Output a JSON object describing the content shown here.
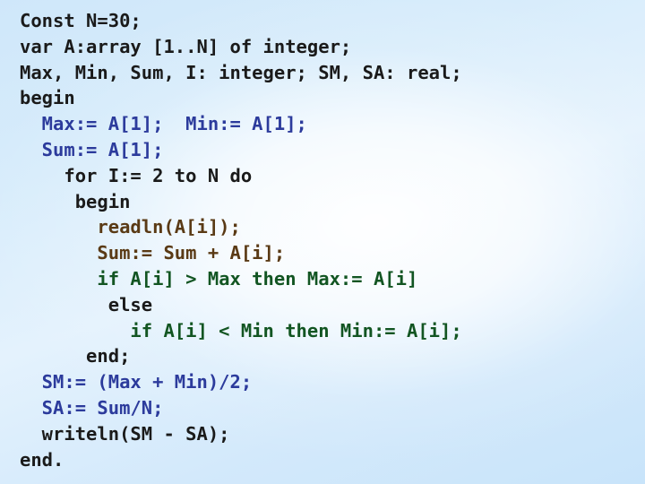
{
  "slide": {
    "title": "Pascal code listing slide",
    "background": {
      "type": "gradient",
      "colors": [
        "#cfe7fa",
        "#e4f2fd",
        "#c8e4fa"
      ]
    },
    "palette": {
      "black": "#1a1a1a",
      "blue": "#2c3b9c",
      "brown": "#5a3a15",
      "green": "#125522"
    },
    "code_lines": [
      {
        "text": "Const N=30;",
        "color": "black"
      },
      {
        "text": "var A:array [1..N] of integer;",
        "color": "black"
      },
      {
        "text": "Max, Min, Sum, I: integer; SM, SA: real;",
        "color": "black"
      },
      {
        "text": "begin",
        "color": "black"
      },
      {
        "text": "  Max:= A[1];  Min:= A[1];",
        "color": "blue"
      },
      {
        "text": "  Sum:= A[1];",
        "color": "blue"
      },
      {
        "text": "    for I:= 2 to N do",
        "color": "black"
      },
      {
        "text": "     begin",
        "color": "black"
      },
      {
        "text": "       readln(A[i]);",
        "color": "brown"
      },
      {
        "text": "       Sum:= Sum + A[i];",
        "color": "brown"
      },
      {
        "text": "       if A[i] > Max then Max:= A[i]",
        "color": "green"
      },
      {
        "text": "        else",
        "color": "black"
      },
      {
        "text": "          if A[i] < Min then Min:= A[i];",
        "color": "green"
      },
      {
        "text": "      end;",
        "color": "black"
      },
      {
        "text": "  SM:= (Max + Min)/2;",
        "color": "blue"
      },
      {
        "text": "  SA:= Sum/N;",
        "color": "blue"
      },
      {
        "text": "  writeln(SM - SA);",
        "color": "black"
      },
      {
        "text": "end.",
        "color": "black"
      }
    ]
  }
}
